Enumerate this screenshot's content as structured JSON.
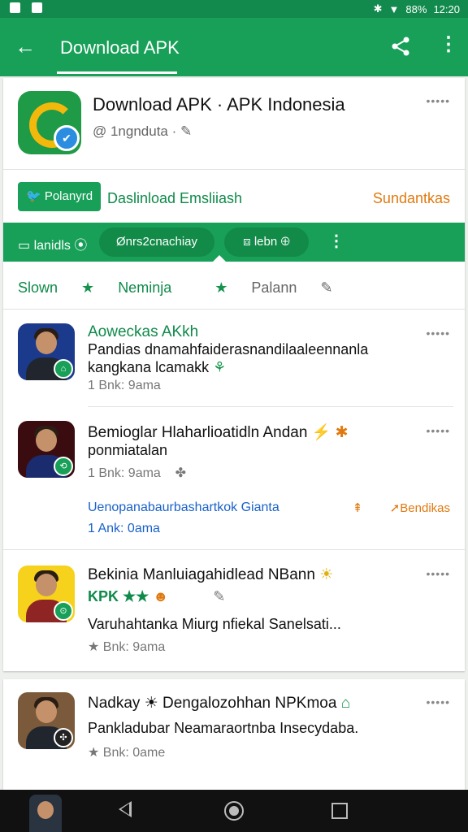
{
  "status_bar": {
    "battery": "88%",
    "time": "12:20"
  },
  "app_bar": {
    "back_icon": "arrow-left-icon",
    "title": "Download APK",
    "share_icon": "share-icon",
    "more_icon": "more-vert-icon"
  },
  "header": {
    "app_title": "Download APK · APK Indonesia",
    "app_subtitle": "@ 1ngnduta · ✎",
    "developer_chip": "Polanyrd",
    "download_text": "Daslinload Emsliiash",
    "sund_text": "Sundantkas",
    "dots": "•••••"
  },
  "tabs": {
    "tab_a": "▭ lanidls ⦿",
    "tab_b": "Ønrs2cnachiay",
    "tab_c": "⧈ lebn ⊕",
    "more": "⋮"
  },
  "filters": {
    "f1": "Slown",
    "f2": "Neminja",
    "f3": "Palann"
  },
  "items": [
    {
      "title": "Aoweckas AKkh",
      "line1": "Pandias dnamahfaiderasnandilaaleennanla",
      "line2": "kangkana lcamakk",
      "meta": "1 Bnk: 9ama"
    },
    {
      "title": "Bemioglar Hlaharlioatidln Andan",
      "line2": "ponmiatalan",
      "meta": "1 Bnk: 9ama",
      "link": "Uenopanabaurbashartkok Gianta",
      "orange": "Bendikas",
      "meta2": "1 Ank: 0ama"
    },
    {
      "title": "Bekinia Manluiagahidlead NBann",
      "green": "KPK ★★",
      "line": "Varuhahtanka Miurg nfiekal Sanelsati...",
      "meta": "★ Bnk: 9ama"
    },
    {
      "title": "Nadkay ☀ Dengalozohhan NPKmoa",
      "line": "Pankladubar Neamaraortnba Insecydaba.",
      "meta": "★ Bnk: 0ame"
    }
  ]
}
